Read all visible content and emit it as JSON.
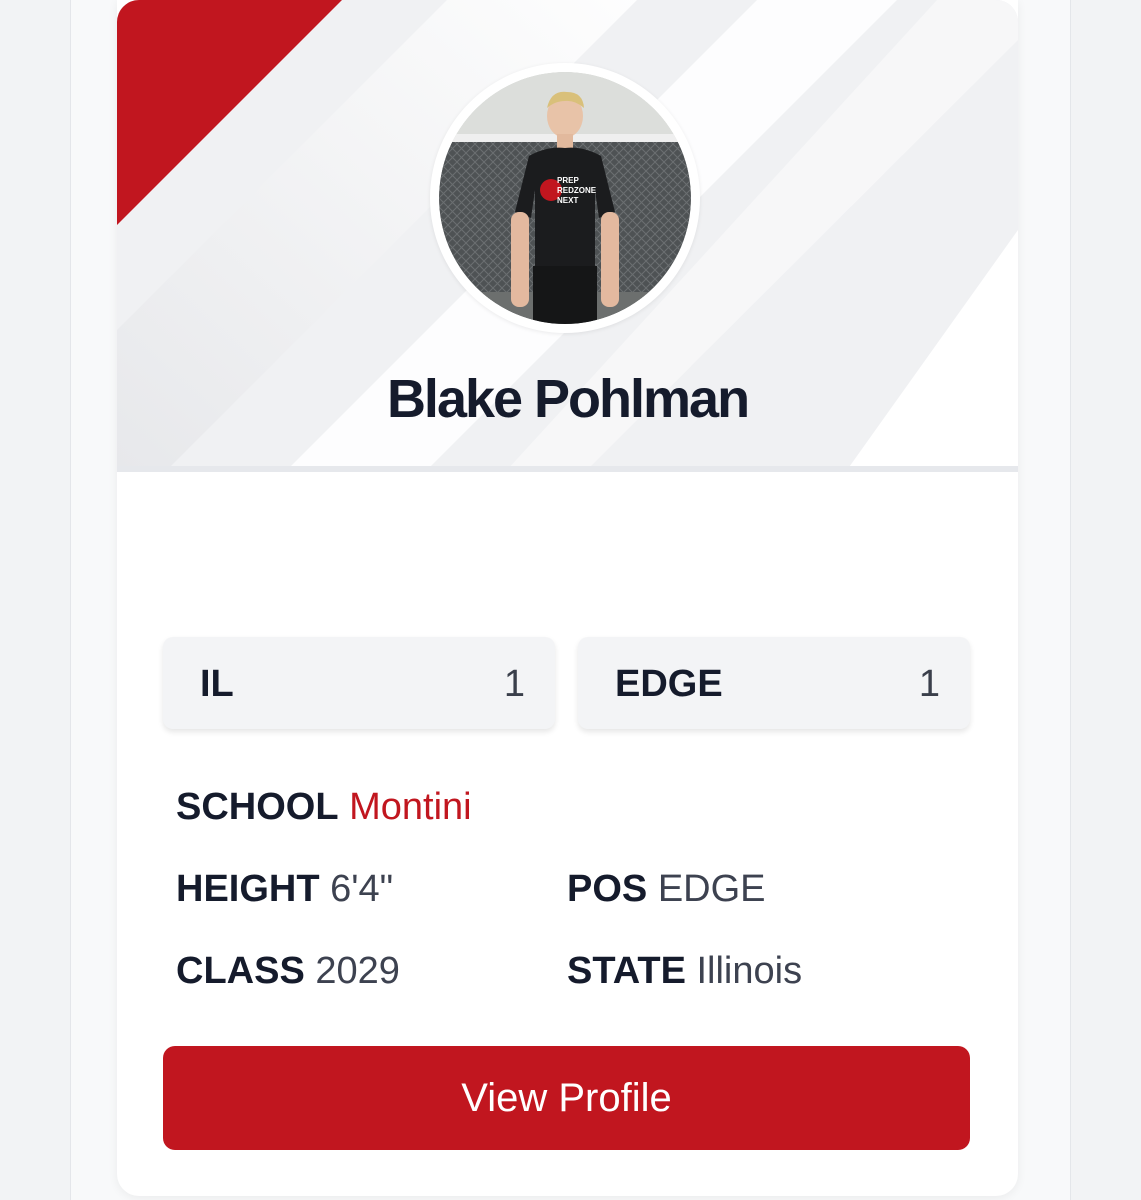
{
  "player": {
    "name": "Blake Pohlman"
  },
  "photo": {
    "shirt_text": [
      "PREP",
      "REDZONE",
      "NEXT"
    ]
  },
  "rankings": [
    {
      "label": "IL",
      "value": "1"
    },
    {
      "label": "EDGE",
      "value": "1"
    }
  ],
  "details": {
    "school_label": "SCHOOL",
    "school_value": "Montini",
    "height_label": "HEIGHT",
    "height_value": "6'4\"",
    "pos_label": "POS",
    "pos_value": "EDGE",
    "class_label": "CLASS",
    "class_value": "2029",
    "state_label": "STATE",
    "state_value": "Illinois"
  },
  "actions": {
    "view_profile": "View Profile"
  },
  "colors": {
    "accent": "#c1161f",
    "text_dark": "#151b2c",
    "text_value": "#3d4250"
  }
}
